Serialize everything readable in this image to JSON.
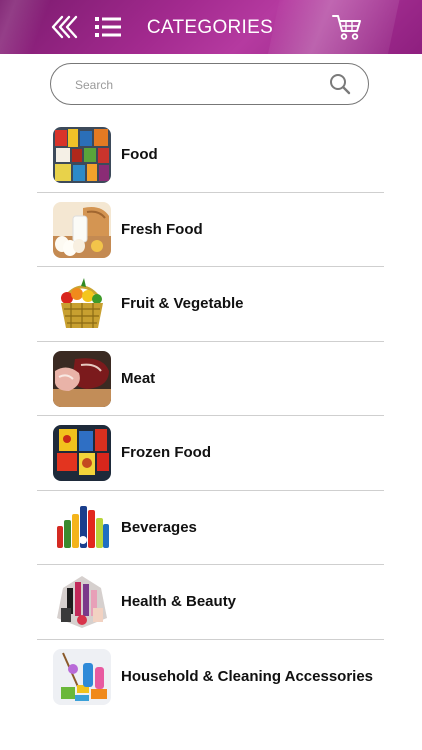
{
  "header": {
    "title": "CATEGORIES",
    "back_icon": "double-chevron-left-icon",
    "menu_icon": "list-menu-icon",
    "cart_icon": "shopping-cart-icon",
    "gradient_colors": [
      "#7a1a6d",
      "#a32a8f",
      "#b53aa0"
    ]
  },
  "search": {
    "placeholder": "Search",
    "value": "",
    "icon": "search-icon"
  },
  "categories": [
    {
      "label": "Food",
      "icon": "food-thumbnail"
    },
    {
      "label": "Fresh Food",
      "icon": "fresh-food-thumbnail"
    },
    {
      "label": "Fruit & Vegetable",
      "icon": "fruit-vegetable-thumbnail"
    },
    {
      "label": "Meat",
      "icon": "meat-thumbnail"
    },
    {
      "label": "Frozen Food",
      "icon": "frozen-food-thumbnail"
    },
    {
      "label": "Beverages",
      "icon": "beverages-thumbnail"
    },
    {
      "label": "Health & Beauty",
      "icon": "health-beauty-thumbnail"
    },
    {
      "label": "Household & Cleaning Accessories",
      "icon": "household-cleaning-thumbnail"
    }
  ]
}
